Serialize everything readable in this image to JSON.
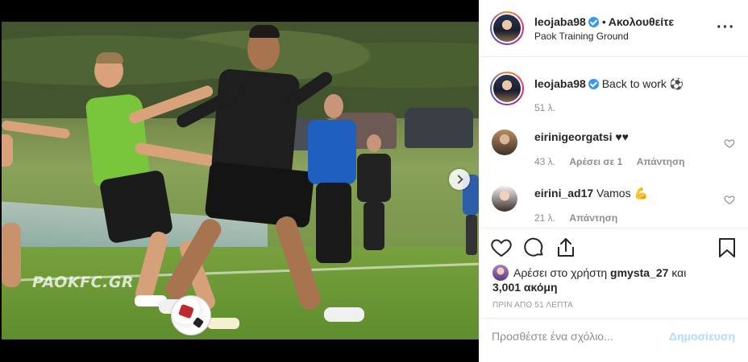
{
  "post": {
    "username": "leojaba98",
    "follow_label": "Ακολουθείτε",
    "separator": "•",
    "location": "Paok Training Ground",
    "watermark": "PAOKFC.GR"
  },
  "comments": [
    {
      "username": "leojaba98",
      "text": "Back to work ⚽",
      "time": "51 λ.",
      "likes": "",
      "reply": ""
    },
    {
      "username": "eirinigeorgatsi",
      "text": "♥♥",
      "time": "43 λ.",
      "likes": "Αρέσει σε 1",
      "reply": "Απάντηση"
    },
    {
      "username": "eirini_ad17",
      "text": "Vamos 💪",
      "time": "21 λ.",
      "likes": "",
      "reply": "Απάντηση"
    }
  ],
  "likes": {
    "prefix": "Αρέσει στο χρήστη",
    "user": "gmysta_27",
    "suffix": "και",
    "count": "3,001 ακόμη"
  },
  "timestamp": "ΠΡΙΝ ΑΠΟ 51 ΛΕΠΤΑ",
  "add_comment": {
    "placeholder": "Προσθέστε ένα σχόλιο...",
    "post_label": "Δημοσίευση"
  },
  "icons": [
    "verified-icon",
    "more-icon",
    "heart-icon",
    "comment-icon",
    "share-icon",
    "bookmark-icon",
    "next-arrow-icon"
  ],
  "colors": {
    "verified": "#3897f0",
    "post_button": "#b3dbff",
    "muted": "#8e8e8e"
  }
}
